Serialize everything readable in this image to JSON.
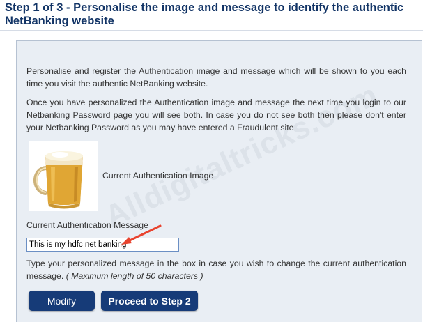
{
  "header": {
    "title": "Step 1 of 3 - Personalise the image and message to identify the authentic NetBanking website"
  },
  "panel": {
    "intro_1": "Personalise and register the Authentication image and message which will be shown to you each time you visit the authentic NetBanking website.",
    "intro_2": "Once you have personalized the Authentication image and message the next time you login to our Netbanking Password page you will see both. In case you do not see both then please don't enter your Netbanking Password as you may have entered a Fraudulent site",
    "watermark": "Alldigitaltricks.com",
    "image_label": "Current Authentication Image",
    "message_label": "Current Authentication Message",
    "message_value": "This is my hdfc net banking",
    "hint_text": "Type your personalized message in the box in case you wish to change the current authentication message.",
    "hint_limit": "( Maximum length of 50 characters )"
  },
  "buttons": {
    "modify": "Modify",
    "proceed": "Proceed to Step 2"
  },
  "colors": {
    "title": "#123466",
    "panel_bg": "#e9eef4",
    "button_bg": "#163b78",
    "annotation_arrow": "#e8432e"
  },
  "icons": {
    "authentication_image": "beer-mug-image",
    "annotation": "red-arrow-icon"
  }
}
